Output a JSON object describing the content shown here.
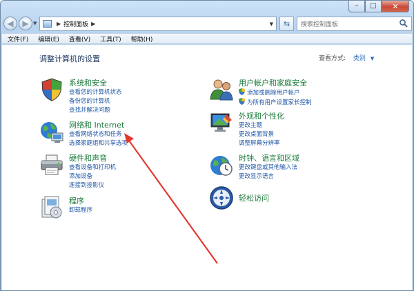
{
  "window": {
    "caption_buttons": {
      "minimize": "–",
      "maximize": "□",
      "close": "✕"
    }
  },
  "address_bar": {
    "breadcrumb": "控制面板",
    "search_placeholder": "搜索控制面板"
  },
  "menu": [
    "文件(F)",
    "编辑(E)",
    "查看(V)",
    "工具(T)",
    "帮助(H)"
  ],
  "main": {
    "heading": "调整计算机的设置",
    "view_by_label": "查看方式:",
    "view_by_value": "类别"
  },
  "categories": {
    "system_security": {
      "title": "系统和安全",
      "links": [
        "查看您的计算机状态",
        "备份您的计算机",
        "查找并解决问题"
      ]
    },
    "network": {
      "title": "网络和 Internet",
      "links": [
        "查看网络状态和任务",
        "选择家庭组和共享选项"
      ]
    },
    "hardware": {
      "title": "硬件和声音",
      "links": [
        "查看设备和打印机",
        "添加设备",
        "连接到投影仪"
      ]
    },
    "programs": {
      "title": "程序",
      "links": [
        "卸载程序"
      ]
    },
    "user_accounts": {
      "title": "用户帐户和家庭安全",
      "links": [
        "添加或删除用户帐户",
        "为所有用户设置家长控制"
      ]
    },
    "appearance": {
      "title": "外观和个性化",
      "links": [
        "更改主题",
        "更改桌面背景",
        "调整屏幕分辨率"
      ]
    },
    "clock": {
      "title": "时钟、语言和区域",
      "links": [
        "更改键盘或其他输入法",
        "更改显示语言"
      ]
    },
    "ease": {
      "title": "轻松访问"
    }
  },
  "colors": {
    "category_title": "#1a7a3a",
    "link": "#1f57a6",
    "annotation_arrow": "#e23a2f"
  },
  "icons": {
    "system_security": "shield-icon",
    "network": "network-globe-icon",
    "hardware": "printer-icon",
    "programs": "programs-icon",
    "user_accounts": "users-icon",
    "appearance": "monitor-icon",
    "clock": "clock-globe-icon",
    "ease": "ease-of-access-icon"
  }
}
